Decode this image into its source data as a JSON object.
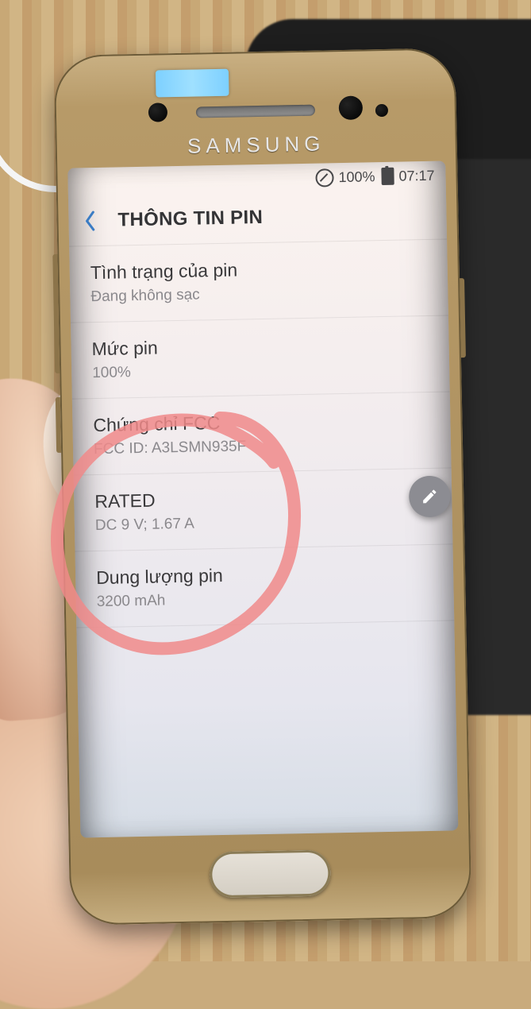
{
  "phone_brand": "SAMSUNG",
  "status_bar": {
    "battery_pct": "100%",
    "clock": "07:17"
  },
  "header": {
    "title": "THÔNG TIN PIN"
  },
  "items": [
    {
      "label": "Tình trạng của pin",
      "value": "Đang không sạc"
    },
    {
      "label": "Mức pin",
      "value": "100%"
    },
    {
      "label": "Chứng chỉ FCC",
      "value": "FCC ID: A3LSMN935F"
    },
    {
      "label": "RATED",
      "value": "DC 9 V; 1.67 A"
    },
    {
      "label": "Dung lượng pin",
      "value": "3200 mAh"
    }
  ]
}
